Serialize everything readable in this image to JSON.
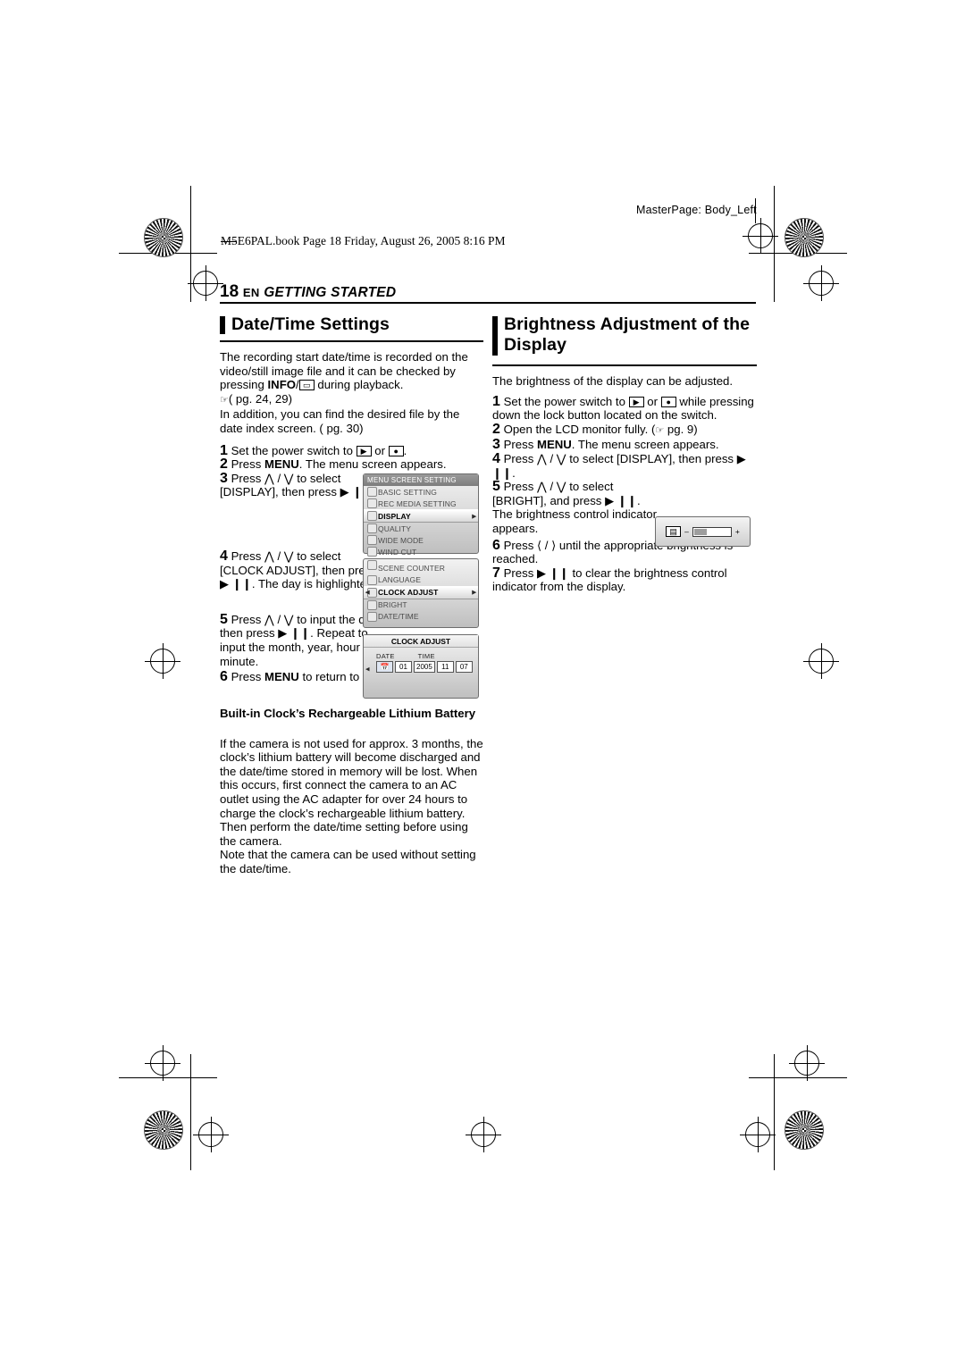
{
  "page": {
    "masterpage": "MasterPage: Body_Left",
    "bookline": "M5E6PAL.book  Page 18  Friday, August 26, 2005  8:16 PM",
    "page_number": "18",
    "lang": "EN",
    "section": "GETTING STARTED"
  },
  "left": {
    "title": "Date/Time Settings",
    "intro1": "The recording start date/time is recorded on the video/still image file and it can be checked by pressing ",
    "intro1_bold": "INFO",
    "intro1_slash": "/",
    "intro1_cont": " during playback.",
    "intro2": "( pg. 24, 29)",
    "intro3": "In addition, you can find the desired file by the date index screen. ( pg. 30)",
    "step1": "Set the power switch to    or   .",
    "step2_a": "Press ",
    "step2_b": "MENU",
    "step2_c": ". The menu screen appears.",
    "step3": "Press  /  to select [DISPLAY], then press  .",
    "step4": "Press  /  to select [CLOCK ADJUST], then press  . The day is highlighted.",
    "step5": "Press  /  to input the day, then press  . Repeat to input the month, year, hour and minute.",
    "step6_a": "Press ",
    "step6_b": "MENU",
    "step6_c": " to return to the normal screen.",
    "battery_head": "Built-in Clock’s Rechargeable Lithium Battery",
    "battery_body": "If the camera is not used for approx. 3 months, the clock’s lithium battery will become discharged and the date/time stored in memory will be lost. When this occurs, first connect the camera to an AC outlet using the AC adapter for over 24 hours to charge the clock’s rechargeable lithium battery. Then perform the date/time setting before using the camera.",
    "battery_note": "Note that the camera can be used without setting the date/time."
  },
  "right": {
    "title_line1": "Brightness Adjustment of the",
    "title_line2": "Display",
    "intro": "The brightness of the display can be adjusted.",
    "step1": "Set the power switch to    or    while pressing down the lock button located on the switch.",
    "step2": "Open the LCD monitor fully. ( pg. 9)",
    "step3_a": "Press ",
    "step3_b": "MENU",
    "step3_c": ". The menu screen appears.",
    "step4": "Press  /  to select [DISPLAY], then press  .",
    "step5": "Press  /  to select [BRIGHT], and press  . The brightness control indicator appears.",
    "step6": "Press  /  until the appropriate brightness is reached.",
    "step7": "Press    to clear the brightness control indicator from the display."
  },
  "screens": {
    "menu1": {
      "header": "MENU SCREEN SETTING",
      "rows": [
        "BASIC SETTING",
        "REC MEDIA SETTING",
        "DISPLAY",
        "QUALITY",
        "WIDE MODE",
        "WIND CUT"
      ],
      "selected_index": 2
    },
    "menu2": {
      "rows": [
        "SCENE COUNTER",
        "LANGUAGE",
        "CLOCK ADJUST",
        "BRIGHT",
        "DATE/TIME"
      ],
      "selected_index": 2
    },
    "clock": {
      "title": "CLOCK ADJUST",
      "col_date": "DATE",
      "col_time": "TIME",
      "values": [
        "01",
        "2005",
        "11",
        "07"
      ]
    },
    "bright": {
      "minus": "–",
      "plus": "+"
    }
  },
  "step_numbers": {
    "n1": "1",
    "n2": "2",
    "n3": "3",
    "n4": "4",
    "n5": "5",
    "n6": "6",
    "n7": "7"
  }
}
